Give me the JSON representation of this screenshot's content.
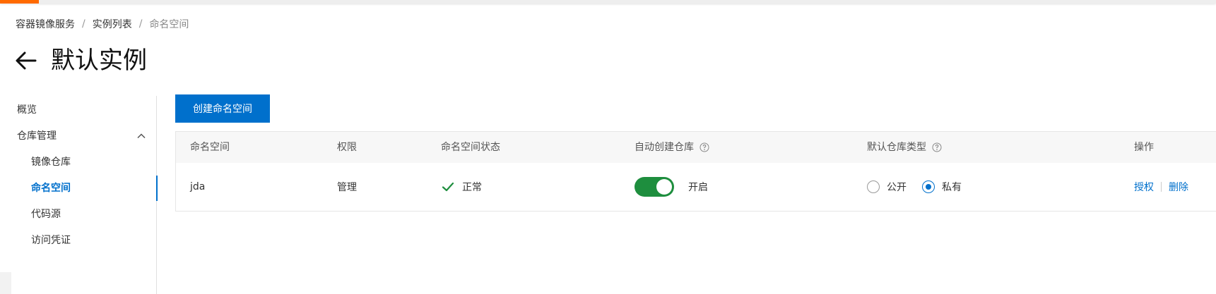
{
  "breadcrumb": [
    "容器镜像服务",
    "实例列表",
    "命名空间"
  ],
  "breadcrumb_separator": "/",
  "page": {
    "title": "默认实例"
  },
  "sidebar": {
    "items": [
      {
        "label": "概览"
      },
      {
        "label": "仓库管理"
      },
      {
        "label": "镜像仓库"
      },
      {
        "label": "命名空间"
      },
      {
        "label": "代码源"
      },
      {
        "label": "访问凭证"
      }
    ]
  },
  "toolbar": {
    "create_label": "创建命名空间"
  },
  "table": {
    "headers": [
      "命名空间",
      "权限",
      "命名空间状态",
      "自动创建仓库",
      "默认仓库类型",
      "操作"
    ],
    "rows": [
      {
        "namespace": "jda",
        "permission": "管理",
        "status": "正常",
        "auto_create": "开启",
        "repo_type_options": [
          "公开",
          "私有"
        ],
        "repo_type_selected": "私有",
        "actions": [
          "授权",
          "删除"
        ]
      }
    ]
  },
  "colors": {
    "accent": "#ff6a00",
    "primary": "#0070cc",
    "success": "#1e8e3e"
  },
  "icons": {
    "back": "arrow-left-icon",
    "expand": "chevron-up-icon",
    "help": "question-circle-icon",
    "status_ok": "check-icon"
  }
}
